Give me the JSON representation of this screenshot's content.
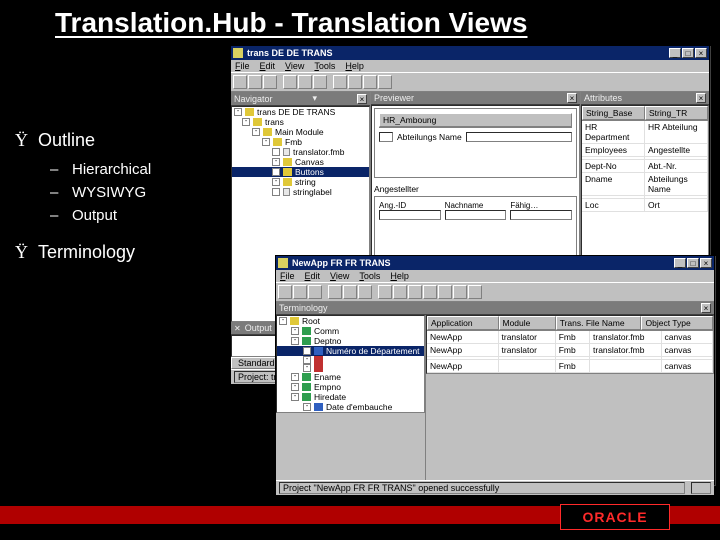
{
  "slide": {
    "title": "Translation.Hub - Translation Views",
    "bullets": [
      {
        "mark": "Ÿ",
        "text": "Outline",
        "subs": [
          "Hierarchical",
          "WYSIWYG",
          "Output"
        ]
      },
      {
        "mark": "Ÿ",
        "text": "Terminology",
        "subs": []
      }
    ]
  },
  "footer": {
    "logo": "ORACLE"
  },
  "win1": {
    "title": "trans DE DE TRANS",
    "menu": [
      "File",
      "Edit",
      "View",
      "Tools",
      "Help"
    ],
    "panes": {
      "navigator": "Navigator",
      "previewer": "Previewer",
      "attributes": "Attributes"
    },
    "nav_tree": {
      "root": "trans DE DE TRANS",
      "items": [
        {
          "i": "folder-y",
          "t": "trans",
          "pad": 10
        },
        {
          "i": "folder-y",
          "t": "Main Module",
          "pad": 20
        },
        {
          "i": "folder-y",
          "t": "Fmb",
          "pad": 30
        },
        {
          "i": "page",
          "t": "translator.fmb",
          "pad": 40
        },
        {
          "i": "folder-y",
          "t": "Canvas",
          "pad": 40
        },
        {
          "i": "folder-y",
          "t": "Buttons",
          "pad": 40,
          "sel": true
        },
        {
          "i": "folder-y",
          "t": "string",
          "pad": 40
        },
        {
          "i": "page",
          "t": "stringlabel",
          "pad": 40
        }
      ]
    },
    "previewer": {
      "tabs": [
        "HR_Amboung"
      ],
      "cols": [
        "Abteilungs Name"
      ],
      "sub": "Angestellter",
      "fields": [
        "Ang.-ID",
        "Nachname",
        "Fähig…"
      ]
    },
    "attributes": {
      "cols": [
        "String_Base",
        "String_TR"
      ],
      "rows": [
        [
          "HR Department",
          "HR Abteilung"
        ],
        [
          "Employees",
          "Angestellte"
        ],
        [
          "",
          ""
        ],
        [
          "Dept-No",
          "Abt.-Nr."
        ],
        [
          "Dname",
          "Abteilungs Name"
        ],
        [
          "",
          ""
        ],
        [
          "Loc",
          "Ort"
        ]
      ]
    },
    "output_label": "Output",
    "tab_label": "Standard",
    "status": "Project: trans DE D"
  },
  "win2": {
    "title": "NewApp FR FR TRANS",
    "menu": [
      "File",
      "Edit",
      "View",
      "Tools",
      "Help"
    ],
    "pane_label": "Terminology",
    "tree": [
      {
        "i": "folder-y",
        "t": "Root",
        "pad": 2
      },
      {
        "i": "folder-g",
        "t": "Comm",
        "pad": 14
      },
      {
        "i": "folder-g",
        "t": "Deptno",
        "pad": 14
      },
      {
        "i": "folder-b",
        "t": "Numéro de Département",
        "pad": 26,
        "sel": true
      },
      {
        "i": "folder-r",
        "t": "",
        "pad": 26
      },
      {
        "i": "folder-r",
        "t": "",
        "pad": 26
      },
      {
        "i": "folder-g",
        "t": "Ename",
        "pad": 14
      },
      {
        "i": "folder-g",
        "t": "Empno",
        "pad": 14
      },
      {
        "i": "folder-g",
        "t": "Hiredate",
        "pad": 14
      },
      {
        "i": "folder-b",
        "t": "Date d'embauche",
        "pad": 26
      }
    ],
    "grid_cols": [
      "Application",
      "Module",
      "Trans. File Name",
      "Object Type"
    ],
    "grid_rows": [
      [
        "NewApp",
        "translator",
        "Fmb",
        "translator.fmb",
        "canvas"
      ],
      [
        "NewApp",
        "translator",
        "Fmb",
        "translator.fmb",
        "canvas"
      ],
      [
        "",
        "",
        "",
        "",
        ""
      ],
      [
        "NewApp",
        "",
        "Fmb",
        "",
        "canvas"
      ]
    ],
    "status": "Project \"NewApp FR FR TRANS\" opened successfully"
  }
}
